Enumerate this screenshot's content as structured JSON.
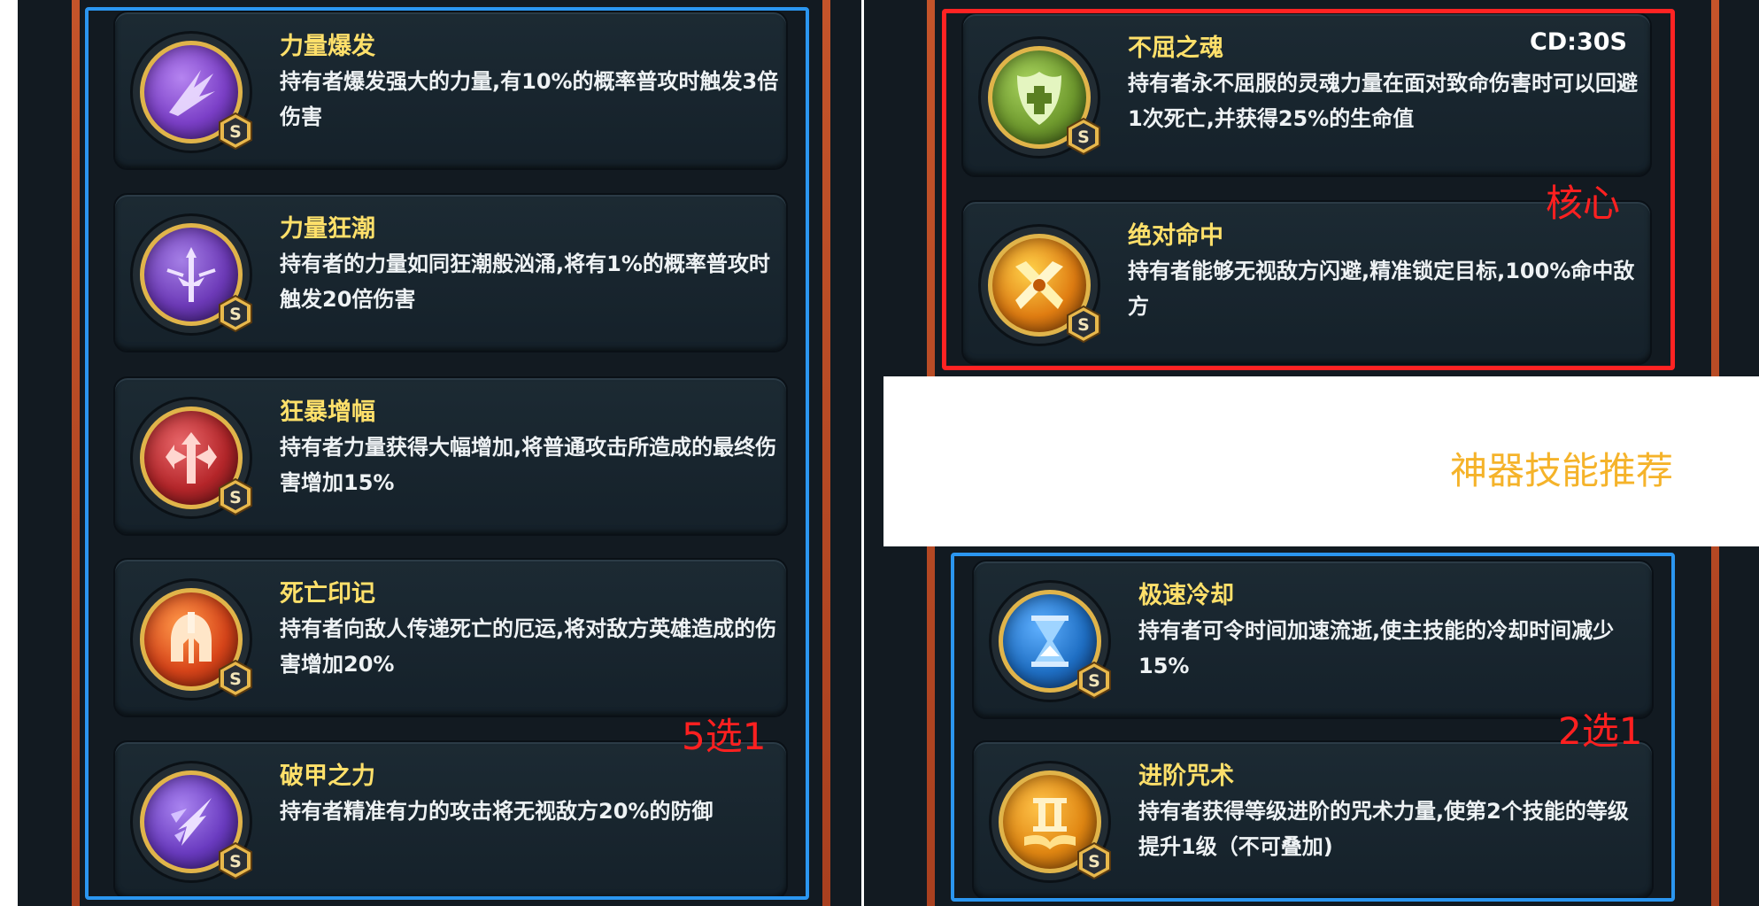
{
  "left_group": {
    "skills": [
      {
        "name": "力量爆发",
        "desc": "持有者爆发强大的力量,有10%的概率普攻时触发3倍伤害",
        "icon": "burst-claw-icon",
        "icon_color": "#7b3fc7",
        "grade": "S"
      },
      {
        "name": "力量狂潮",
        "desc": "持有者的力量如同狂潮般汹涌,将有1%的概率普攻时触发20倍伤害",
        "icon": "sword-surge-icon",
        "icon_color": "#6d3ab8",
        "grade": "S"
      },
      {
        "name": "狂暴增幅",
        "desc": "持有者力量获得大幅增加,将普通攻击所造成的最终伤害增加15%",
        "icon": "rage-arrows-icon",
        "icon_color": "#b5262a",
        "grade": "S"
      },
      {
        "name": "死亡印记",
        "desc": "持有者向敌人传递死亡的厄运,将对敌方英雄造成的伤害增加20%",
        "icon": "spartan-helmet-icon",
        "icon_color": "#d8451a",
        "grade": "S"
      },
      {
        "name": "破甲之力",
        "desc": "持有者精准有力的攻击将无视敌方20%的防御",
        "icon": "armor-pierce-icon",
        "icon_color": "#6a3bc0",
        "grade": "S"
      }
    ],
    "annotation": "5选1"
  },
  "core_group": {
    "skills": [
      {
        "name": "不屈之魂",
        "desc": "持有者永不屈服的灵魂力量在面对致命伤害时可以回避1次死亡,并获得25%的生命值",
        "cooldown": "CD:30S",
        "icon": "soul-shield-icon",
        "icon_color": "#6f9a2e",
        "grade": "S"
      },
      {
        "name": "绝对命中",
        "desc": "持有者能够无视敌方闪避,精准锁定目标,100%命中敌方",
        "icon": "crossed-blades-icon",
        "icon_color": "#e07d12",
        "grade": "S"
      }
    ],
    "annotation": "核心"
  },
  "section_title": "神器技能推荐",
  "right_group": {
    "skills": [
      {
        "name": "极速冷却",
        "desc": "持有者可令时间加速流逝,使主技能的冷却时间减少15%",
        "icon": "hourglass-icon",
        "icon_color": "#1f6fc4",
        "grade": "S"
      },
      {
        "name": "进阶咒术",
        "desc": "持有者获得等级进阶的咒术力量,使第2个技能的等级提升1级（不可叠加)",
        "icon": "roman-two-book-icon",
        "icon_color": "#e08612",
        "grade": "S"
      }
    ],
    "annotation": "2选1"
  },
  "colors": {
    "highlight_blue": "#2b96f0",
    "highlight_red": "#ff2323",
    "title_gold": "#ffe06a",
    "annotation_red": "#ff2020",
    "annotation_yellow": "#f5b32a"
  }
}
